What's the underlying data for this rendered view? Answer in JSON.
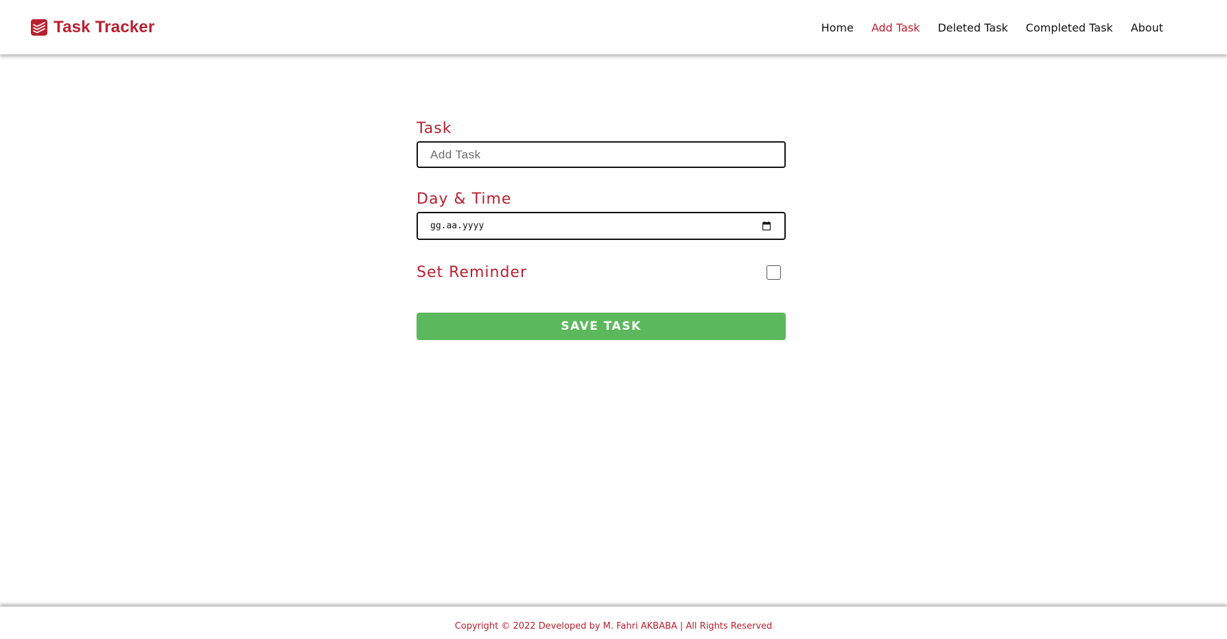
{
  "brand": {
    "name": "Task Tracker",
    "icon": "todoist-logo-icon",
    "color": "#b8202f"
  },
  "nav": {
    "items": [
      {
        "label": "Home"
      },
      {
        "label": "Add Task"
      },
      {
        "label": "Deleted Task"
      },
      {
        "label": "Completed Task"
      },
      {
        "label": "About"
      }
    ],
    "active": "Add Task"
  },
  "form": {
    "task_label": "Task",
    "task_placeholder": "Add Task",
    "task_value": "",
    "datetime_label": "Day & Time",
    "datetime_value": "gg.aa.yyyy",
    "datetime_icon": "calendar-icon",
    "reminder_label": "Set Reminder",
    "reminder_checked": false,
    "save_label": "SAVE TASK",
    "save_color": "#5cb85c"
  },
  "footer": {
    "text": "Copyright © 2022 Developed by M. Fahri AKBABA | All Rights Reserved"
  }
}
